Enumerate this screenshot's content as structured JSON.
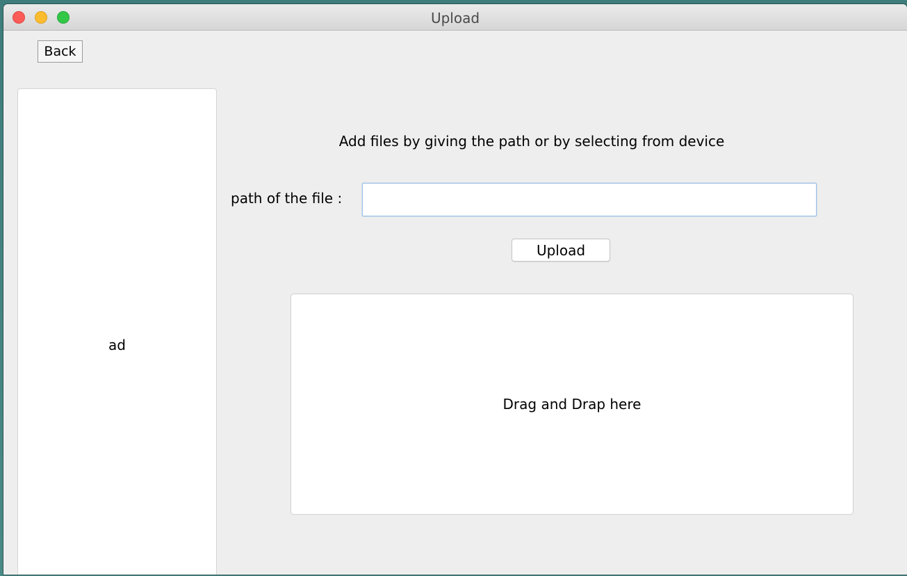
{
  "window": {
    "title": "Upload"
  },
  "toolbar": {
    "back_label": "Back"
  },
  "ad_panel": {
    "label": "ad"
  },
  "upload_form": {
    "instruction": "Add files by giving the path or by selecting from device",
    "path_label": "path of the file :",
    "path_value": "",
    "path_placeholder": "",
    "upload_label": "Upload"
  },
  "drop_zone": {
    "label": "Drag and Drap here"
  },
  "colors": {
    "close": "#fc5b57",
    "minimize": "#fdbc2e",
    "maximize": "#33c748",
    "input_focus_border": "#9cc2e6",
    "window_background": "#eeeeee"
  }
}
